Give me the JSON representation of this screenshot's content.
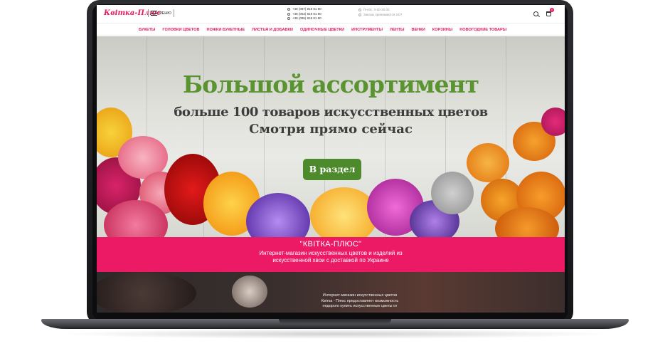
{
  "header": {
    "logo": "Квітка-Плюс",
    "menu_label": "МЕНЮ",
    "phones": [
      "+38 (097) 818 81 80",
      "+38 (063) 818 81 80",
      "+38 (095) 818 81 80"
    ],
    "hours": [
      "Пн-Вс: 9.00-20.00",
      "Заказы принимаются 24/7"
    ],
    "cart_count": "0"
  },
  "nav": {
    "items": [
      "БУКЕТЫ",
      "ГОЛОВКИ ЦВЕТОВ",
      "НОЖКИ БУКЕТНЫЕ",
      "ЛИСТЬЯ И ДОБАВКИ",
      "ОДИНОЧНЫЕ ЦВЕТКИ",
      "ИНСТРУМЕНТЫ",
      "ЛЕНТЫ",
      "ВЕНКИ",
      "КОРЗИНЫ",
      "НОВОГОДНИЕ ТОВАРЫ"
    ]
  },
  "hero": {
    "title": "Большой ассортимент",
    "subtitle1": "больше 100 товаров искусственных цветов",
    "subtitle2": "Смотри прямо сейчас",
    "button": "В раздел"
  },
  "banner": {
    "title": "\"КВІТКА-ПЛЮС\"",
    "line1": "Интернет-магазин искусственных цветов и изделий из",
    "line2": "искусственной хвои с доставкой по Украине"
  },
  "about": {
    "line1": "Интернет-магазин искусственных цветов",
    "line2": "Квітка - Плюс предоставляет возможность",
    "line3": "недорого купить искусственные цветы от"
  },
  "colors": {
    "accent": "#ec1a64",
    "button": "#4c8a2b",
    "title": "#5a9430"
  }
}
